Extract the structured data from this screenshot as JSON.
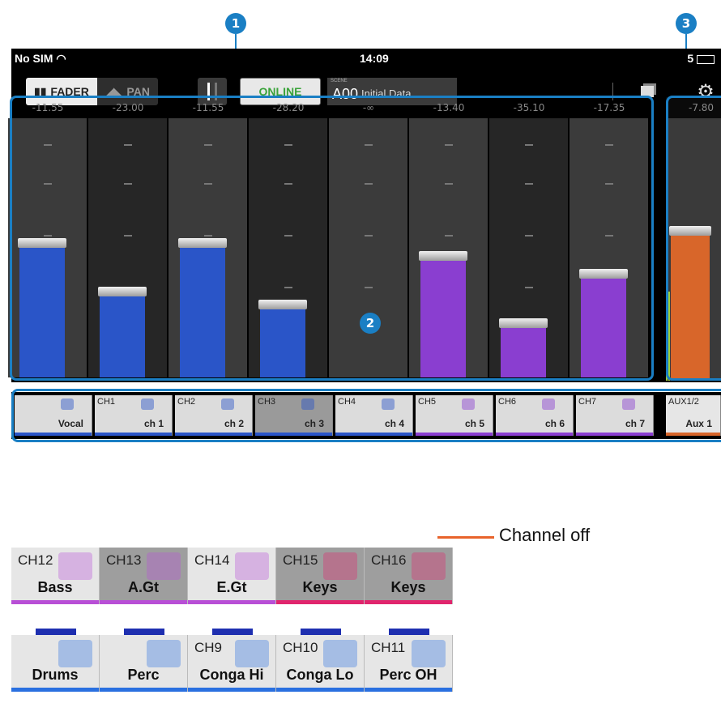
{
  "callouts": {
    "c1": "1",
    "c2": "2",
    "c3": "3"
  },
  "status_bar": {
    "carrier": "No SIM",
    "time": "14:09",
    "battery": "5"
  },
  "toolbar": {
    "fader_label": "FADER",
    "pan_label": "PAN",
    "online_label": "ONLINE",
    "scene_caption": "SCENE",
    "scene_number": "A00",
    "scene_name": "Initial Data"
  },
  "faders": [
    {
      "value": "-11.55",
      "level": 0.52,
      "color": "#2a55c8"
    },
    {
      "value": "-23.00",
      "level": 0.33,
      "color": "#2a55c8"
    },
    {
      "value": "-11.55",
      "level": 0.52,
      "color": "#2a55c8"
    },
    {
      "value": "-28.20",
      "level": 0.28,
      "color": "#2a55c8"
    },
    {
      "value": "-∞",
      "level": 0,
      "color": "#2a55c8"
    },
    {
      "value": "-13.40",
      "level": 0.47,
      "color": "#8a3ed0"
    },
    {
      "value": "-35.10",
      "level": 0.21,
      "color": "#8a3ed0"
    },
    {
      "value": "-17.35",
      "level": 0.4,
      "color": "#8a3ed0"
    }
  ],
  "aux_fader": {
    "value": "-7.80",
    "level": 0.57,
    "color": "#d8662a"
  },
  "channels": [
    {
      "num": "",
      "name": "Vocal",
      "stripe": "#2a55c8",
      "gray": false
    },
    {
      "num": "CH1",
      "name": "ch 1",
      "stripe": "#2a55c8",
      "gray": false
    },
    {
      "num": "CH2",
      "name": "ch 2",
      "stripe": "#2a55c8",
      "gray": false
    },
    {
      "num": "CH3",
      "name": "ch 3",
      "stripe": "#2a55c8",
      "gray": true
    },
    {
      "num": "CH4",
      "name": "ch 4",
      "stripe": "#2a55c8",
      "gray": false
    },
    {
      "num": "CH5",
      "name": "ch 5",
      "stripe": "#8a3ed0",
      "gray": false
    },
    {
      "num": "CH6",
      "name": "ch 6",
      "stripe": "#8a3ed0",
      "gray": false
    },
    {
      "num": "CH7",
      "name": "ch 7",
      "stripe": "#8a3ed0",
      "gray": false
    },
    {
      "num": "AUX1/2",
      "name": "Aux 1",
      "stripe": "#d8662a",
      "gray": false
    }
  ],
  "example_row_1": [
    {
      "num": "CH12",
      "name": "Bass",
      "stripe": "#b84fd6",
      "off": false
    },
    {
      "num": "CH13",
      "name": "A.Gt",
      "stripe": "#b84fd6",
      "off": true
    },
    {
      "num": "CH14",
      "name": "E.Gt",
      "stripe": "#b84fd6",
      "off": false
    },
    {
      "num": "CH15",
      "name": "Keys",
      "stripe": "#e0256d",
      "off": true
    },
    {
      "num": "CH16",
      "name": "Keys",
      "stripe": "#e0256d",
      "off": true
    }
  ],
  "channel_off_label": "Channel off",
  "example_row_2": [
    {
      "num": "",
      "name": "Drums",
      "stripe": "#2a70e0"
    },
    {
      "num": "",
      "name": "Perc",
      "stripe": "#2a70e0"
    },
    {
      "num": "CH9",
      "name": "Conga Hi",
      "stripe": "#2a70e0"
    },
    {
      "num": "CH10",
      "name": "Conga Lo",
      "stripe": "#2a70e0"
    },
    {
      "num": "CH11",
      "name": "Perc OH",
      "stripe": "#2a70e0"
    }
  ]
}
